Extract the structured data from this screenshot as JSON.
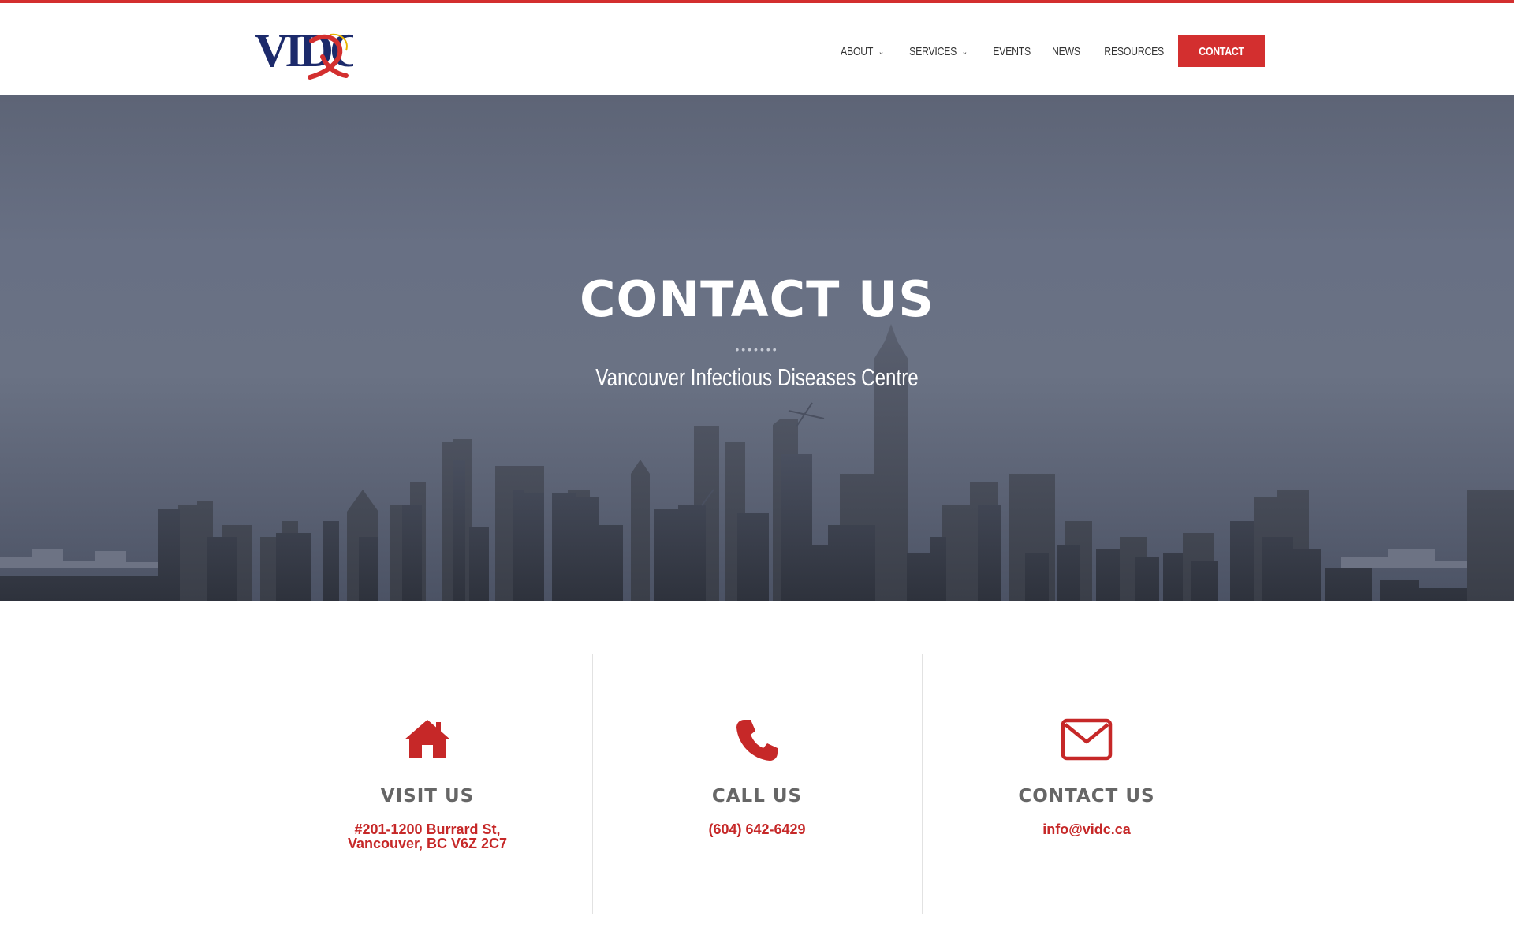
{
  "brand": {
    "logo_text": "VIDC",
    "accent_color": "#d32f2f",
    "navy_color": "#1c2a6b"
  },
  "nav": {
    "items": [
      {
        "label": "About",
        "has_dropdown": true
      },
      {
        "label": "Services",
        "has_dropdown": true
      },
      {
        "label": "Events",
        "has_dropdown": false
      },
      {
        "label": "News",
        "has_dropdown": false
      },
      {
        "label": "Resources",
        "has_dropdown": false
      }
    ],
    "cta_label": "Contact"
  },
  "hero": {
    "title": "CONTACT US",
    "dots": "•••••••",
    "subtitle": "Vancouver Infectious Diseases Centre"
  },
  "contact": {
    "columns": [
      {
        "icon": "home-icon",
        "heading": "VISIT US",
        "value_line1": "#201-1200 Burrard St,",
        "value_line2": "Vancouver, BC V6Z 2C7"
      },
      {
        "icon": "phone-icon",
        "heading": "CALL US",
        "value_line1": "(604) 642-6429",
        "value_line2": ""
      },
      {
        "icon": "envelope-icon",
        "heading": "CONTACT US",
        "value_line1": "info@vidc.ca",
        "value_line2": ""
      }
    ]
  }
}
